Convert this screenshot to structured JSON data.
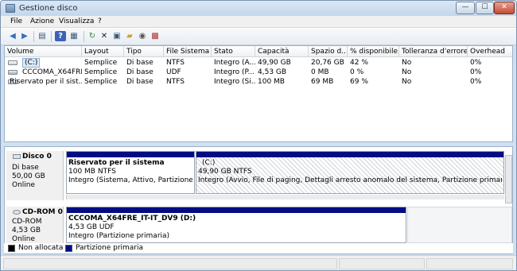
{
  "window": {
    "title": "Gestione disco",
    "min": "—",
    "max": "☐",
    "close": "✕"
  },
  "menu": [
    "File",
    "Azione",
    "Visualizza",
    "?"
  ],
  "toolbar_icons": [
    "back-arrow-icon",
    "forward-arrow-icon",
    "console-tree-icon",
    "help-icon",
    "properties-list-icon",
    "refresh-icon",
    "delete-icon",
    "properties-icon",
    "open-folder-icon",
    "rescan-icon",
    "details-icon"
  ],
  "table": {
    "columns": [
      "Volume",
      "Layout",
      "Tipo",
      "File Sistema",
      "Stato",
      "Capacità",
      "Spazio d...",
      "% disponibile",
      "Tolleranza d'errore",
      "Overhead"
    ],
    "rows": [
      [
        "(C:)",
        "Semplice",
        "Di base",
        "NTFS",
        "Integro (A...",
        "49,90 GB",
        "20,76 GB",
        "42 %",
        "No",
        "0%"
      ],
      [
        "CCCOMA_X64FRE...",
        "Semplice",
        "Di base",
        "UDF",
        "Integro (P...",
        "4,53 GB",
        "0 MB",
        "0 %",
        "No",
        "0%"
      ],
      [
        "Riservato per il sist...",
        "Semplice",
        "Di base",
        "NTFS",
        "Integro (Si...",
        "100 MB",
        "69 MB",
        "69 %",
        "No",
        "0%"
      ]
    ]
  },
  "disks": [
    {
      "name": "Disco 0",
      "type": "Di base",
      "size": "50,00 GB",
      "status": "Online",
      "partitions": [
        {
          "title": "Riservato per il sistema",
          "size": "100 MB NTFS",
          "status": "Integro (Sistema, Attivo, Partizione prima"
        },
        {
          "title": "(C:)",
          "size": "49,90 GB NTFS",
          "status": "Integro (Avvio, File di paging, Dettagli arresto anomalo del sistema, Partizione primaria)"
        }
      ]
    },
    {
      "name": "CD-ROM 0",
      "type": "CD-ROM",
      "size": "4,53 GB",
      "status": "Online",
      "partitions": [
        {
          "title": "CCCOMA_X64FRE_IT-IT_DV9  (D:)",
          "size": "4,53 GB UDF",
          "status": "Integro (Partizione primaria)"
        }
      ]
    }
  ],
  "legend": [
    {
      "label": "Non allocata",
      "color": "#000000"
    },
    {
      "label": "Partizione primaria",
      "color": "#000d83"
    }
  ]
}
